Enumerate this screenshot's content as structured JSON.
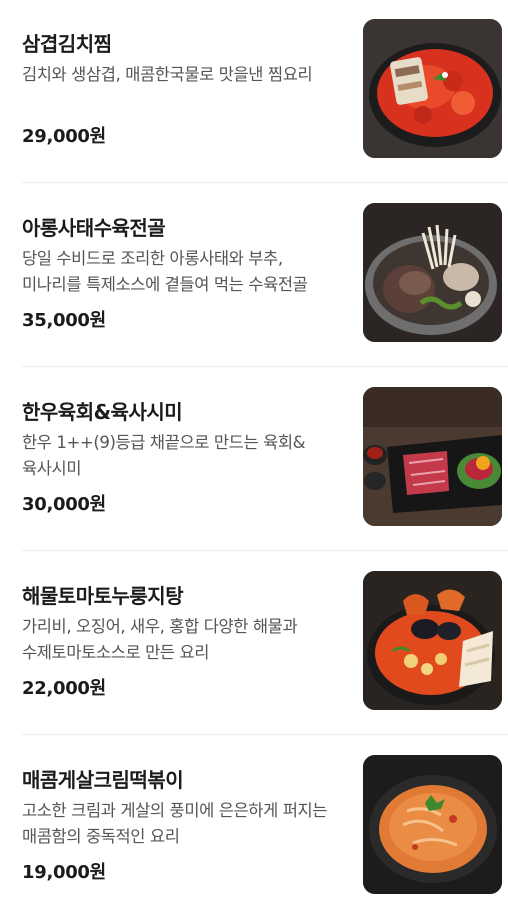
{
  "menu": {
    "items": [
      {
        "name": "삼겹김치찜",
        "description": "김치와 생삼겹, 매콤한국물로 맛을낸 찜요리",
        "price": "29,000원",
        "image": "kimchi-pork-stew-photo"
      },
      {
        "name": "아롱사태수육전골",
        "description": "당일 수비드로 조리한 아롱사태와 부추, 미나리를 특제소스에 곁들여 먹는 수육전골",
        "price": "35,000원",
        "image": "beef-shank-hotpot-photo"
      },
      {
        "name": "한우육회&육사시미",
        "description": "한우 1++(9)등급 채끝으로 만드는 육회&육사시미",
        "price": "30,000원",
        "image": "beef-tartare-platter-photo"
      },
      {
        "name": "해물토마토누룽지탕",
        "description": "가리비, 오징어, 새우, 홍합 다양한 해물과 수제토마토소스로 만든 요리",
        "price": "22,000원",
        "image": "seafood-tomato-scorched-rice-photo"
      },
      {
        "name": "매콤게살크림떡볶이",
        "description": "고소한 크림과 게살의 풍미에 은은하게 퍼지는 매콤함의 중독적인 요리",
        "price": "19,000원",
        "image": "crab-cream-tteokbokki-photo"
      }
    ]
  }
}
